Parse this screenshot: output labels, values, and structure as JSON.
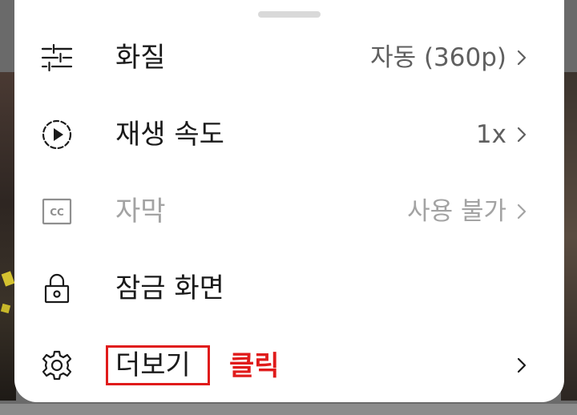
{
  "menu": {
    "items": [
      {
        "icon": "sliders-icon",
        "label": "화질",
        "value": "자동 (360p)",
        "has_chevron": true,
        "enabled": true
      },
      {
        "icon": "playback-speed-icon",
        "label": "재생 속도",
        "value": "1x",
        "has_chevron": true,
        "enabled": true
      },
      {
        "icon": "captions-icon",
        "label": "자막",
        "value": "사용 불가",
        "has_chevron": true,
        "enabled": false
      },
      {
        "icon": "lock-icon",
        "label": "잠금 화면",
        "value": "",
        "has_chevron": false,
        "enabled": true
      },
      {
        "icon": "gear-icon",
        "label": "더보기",
        "value": "",
        "has_chevron": true,
        "enabled": true
      }
    ]
  },
  "annotation": {
    "text": "클릭",
    "color": "#e01b1b"
  },
  "colors": {
    "sheet_background": "#ffffff",
    "label_text": "#1a1a1a",
    "value_text": "#5f5f5f",
    "disabled_text": "#a3a3a3",
    "highlight": "#e01b1b"
  }
}
